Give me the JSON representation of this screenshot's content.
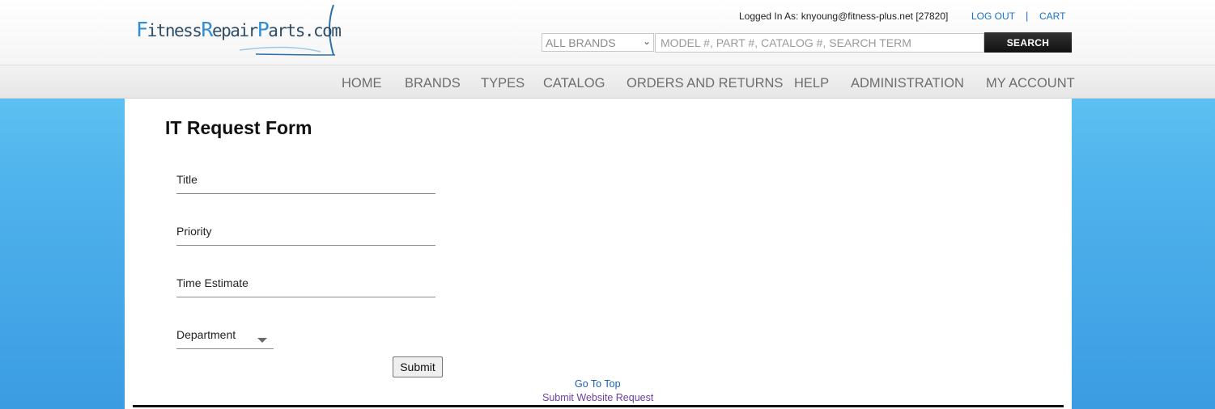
{
  "header": {
    "logo_text": "FitnessRepairParts.com",
    "logged_in_label": "Logged In As: knyoung@fitness-plus.net [27820]",
    "logout_label": "LOG OUT",
    "separator": "|",
    "cart_label": "CART"
  },
  "search": {
    "brand_selected": "ALL BRANDS",
    "placeholder": "MODEL #, PART #, CATALOG #, SEARCH TERM",
    "button_label": "SEARCH"
  },
  "nav": {
    "items": [
      {
        "label": "HOME"
      },
      {
        "label": "BRANDS"
      },
      {
        "label": "TYPES"
      },
      {
        "label": "CATALOG"
      },
      {
        "label": "ORDERS AND RETURNS"
      },
      {
        "label": "HELP"
      },
      {
        "label": "ADMINISTRATION"
      },
      {
        "label": "MY ACCOUNT"
      }
    ]
  },
  "form": {
    "title": "IT Request Form",
    "fields": [
      {
        "label": "Title"
      },
      {
        "label": "Priority"
      },
      {
        "label": "Time Estimate"
      },
      {
        "label": "Department"
      }
    ],
    "submit_label": "Submit"
  },
  "footer": {
    "go_to_top": "Go To Top",
    "submit_website_request": "Submit Website Request"
  },
  "colors": {
    "link": "#1a73c4",
    "visited_link": "#6a3fa0",
    "background_top": "#6ccff8",
    "background_bottom": "#3b9ce2"
  }
}
